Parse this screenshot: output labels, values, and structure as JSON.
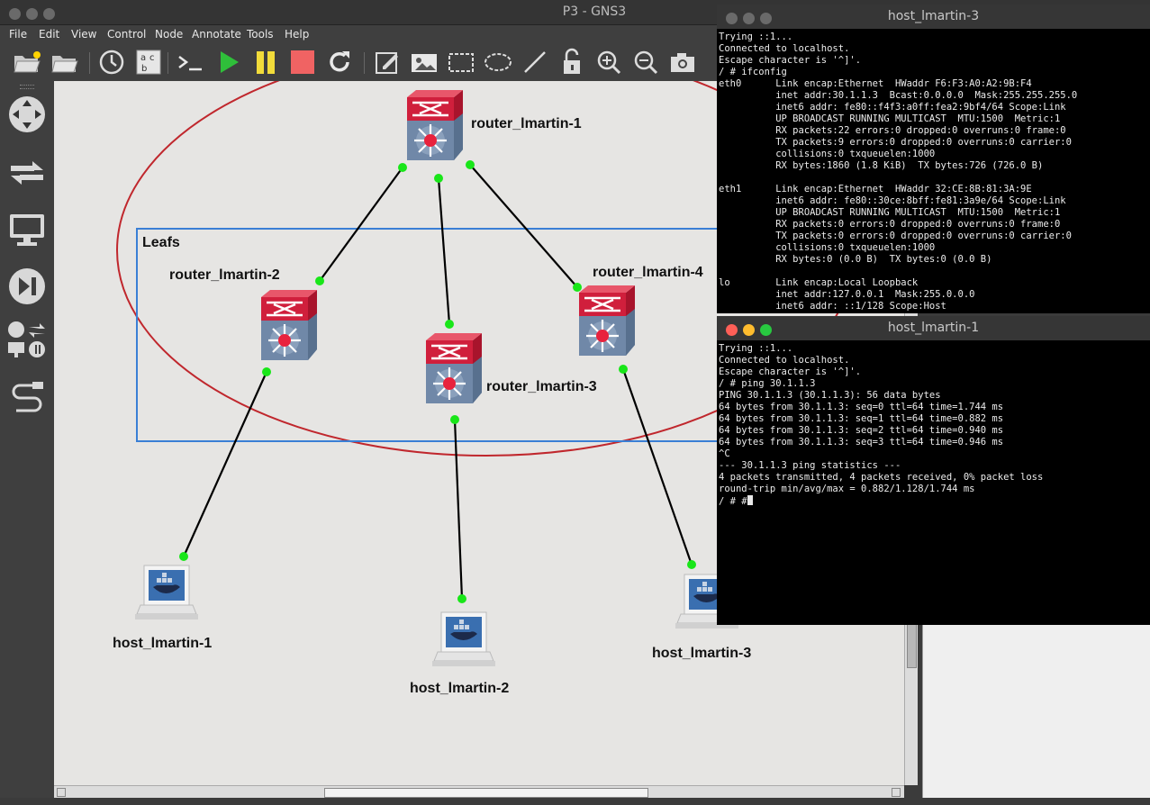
{
  "window": {
    "title": "P3 - GNS3"
  },
  "menu": [
    "File",
    "Edit",
    "View",
    "Control",
    "Node",
    "Annotate",
    "Tools",
    "Help"
  ],
  "toolbar_icons": [
    "open-project-icon",
    "open-folder-icon",
    "snapshot-clock-icon",
    "show-labels-icon",
    "console-all-icon",
    "start-all-icon",
    "pause-all-icon",
    "stop-all-icon",
    "reload-all-icon",
    "add-note-icon",
    "insert-image-icon",
    "draw-rectangle-icon",
    "draw-ellipse-icon",
    "draw-line-icon",
    "lock-icon",
    "zoom-in-icon",
    "zoom-out-icon",
    "screenshot-icon"
  ],
  "sidebar_icons": [
    "routers-icon",
    "switches-icon",
    "end-devices-icon",
    "security-devices-icon",
    "all-devices-icon",
    "add-link-icon"
  ],
  "topology": {
    "group_label": "Leafs",
    "routers": [
      {
        "name": "router_lmartin-1"
      },
      {
        "name": "router_lmartin-2"
      },
      {
        "name": "router_lmartin-3"
      },
      {
        "name": "router_lmartin-4"
      }
    ],
    "hosts": [
      {
        "name": "host_lmartin-1"
      },
      {
        "name": "host_lmartin-2"
      },
      {
        "name": "host_lmartin-3"
      }
    ],
    "colors": {
      "ellipse": "#c0272d",
      "rectangle": "#3a7fd5",
      "link_port": "#19e619",
      "router_top": "#d01f3c",
      "router_body": "#7088a8"
    }
  },
  "terminal_top": {
    "title": "host_lmartin-3",
    "lines": [
      "Trying ::1...",
      "Connected to localhost.",
      "Escape character is '^]'.",
      "/ # ifconfig",
      "eth0      Link encap:Ethernet  HWaddr F6:F3:A0:A2:9B:F4",
      "          inet addr:30.1.1.3  Bcast:0.0.0.0  Mask:255.255.255.0",
      "          inet6 addr: fe80::f4f3:a0ff:fea2:9bf4/64 Scope:Link",
      "          UP BROADCAST RUNNING MULTICAST  MTU:1500  Metric:1",
      "          RX packets:22 errors:0 dropped:0 overruns:0 frame:0",
      "          TX packets:9 errors:0 dropped:0 overruns:0 carrier:0",
      "          collisions:0 txqueuelen:1000",
      "          RX bytes:1860 (1.8 KiB)  TX bytes:726 (726.0 B)",
      "",
      "eth1      Link encap:Ethernet  HWaddr 32:CE:8B:81:3A:9E",
      "          inet6 addr: fe80::30ce:8bff:fe81:3a9e/64 Scope:Link",
      "          UP BROADCAST RUNNING MULTICAST  MTU:1500  Metric:1",
      "          RX packets:0 errors:0 dropped:0 overruns:0 frame:0",
      "          TX packets:0 errors:0 dropped:0 overruns:0 carrier:0",
      "          collisions:0 txqueuelen:1000",
      "          RX bytes:0 (0.0 B)  TX bytes:0 (0.0 B)",
      "",
      "lo        Link encap:Local Loopback",
      "          inet addr:127.0.0.1  Mask:255.0.0.0",
      "          inet6 addr: ::1/128 Scope:Host"
    ]
  },
  "terminal_bottom": {
    "title": "host_lmartin-1",
    "lines": [
      "Trying ::1...",
      "Connected to localhost.",
      "Escape character is '^]'.",
      "/ # ping 30.1.1.3",
      "PING 30.1.1.3 (30.1.1.3): 56 data bytes",
      "64 bytes from 30.1.1.3: seq=0 ttl=64 time=1.744 ms",
      "64 bytes from 30.1.1.3: seq=1 ttl=64 time=0.882 ms",
      "64 bytes from 30.1.1.3: seq=2 ttl=64 time=0.940 ms",
      "64 bytes from 30.1.1.3: seq=3 ttl=64 time=0.946 ms",
      "^C",
      "--- 30.1.1.3 ping statistics ---",
      "4 packets transmitted, 4 packets received, 0% packet loss",
      "round-trip min/avg/max = 0.882/1.128/1.744 ms"
    ],
    "prompt": "/ # #"
  }
}
